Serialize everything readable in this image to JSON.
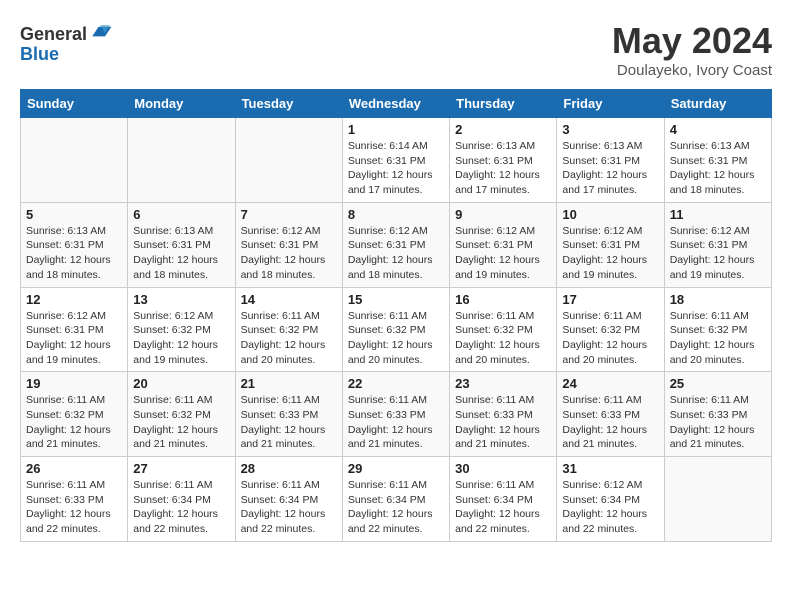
{
  "header": {
    "logo_line1": "General",
    "logo_line2": "Blue",
    "title": "May 2024",
    "location": "Doulayeko, Ivory Coast"
  },
  "days_of_week": [
    "Sunday",
    "Monday",
    "Tuesday",
    "Wednesday",
    "Thursday",
    "Friday",
    "Saturday"
  ],
  "weeks": [
    [
      {
        "num": "",
        "info": ""
      },
      {
        "num": "",
        "info": ""
      },
      {
        "num": "",
        "info": ""
      },
      {
        "num": "1",
        "info": "Sunrise: 6:14 AM\nSunset: 6:31 PM\nDaylight: 12 hours\nand 17 minutes."
      },
      {
        "num": "2",
        "info": "Sunrise: 6:13 AM\nSunset: 6:31 PM\nDaylight: 12 hours\nand 17 minutes."
      },
      {
        "num": "3",
        "info": "Sunrise: 6:13 AM\nSunset: 6:31 PM\nDaylight: 12 hours\nand 17 minutes."
      },
      {
        "num": "4",
        "info": "Sunrise: 6:13 AM\nSunset: 6:31 PM\nDaylight: 12 hours\nand 18 minutes."
      }
    ],
    [
      {
        "num": "5",
        "info": "Sunrise: 6:13 AM\nSunset: 6:31 PM\nDaylight: 12 hours\nand 18 minutes."
      },
      {
        "num": "6",
        "info": "Sunrise: 6:13 AM\nSunset: 6:31 PM\nDaylight: 12 hours\nand 18 minutes."
      },
      {
        "num": "7",
        "info": "Sunrise: 6:12 AM\nSunset: 6:31 PM\nDaylight: 12 hours\nand 18 minutes."
      },
      {
        "num": "8",
        "info": "Sunrise: 6:12 AM\nSunset: 6:31 PM\nDaylight: 12 hours\nand 18 minutes."
      },
      {
        "num": "9",
        "info": "Sunrise: 6:12 AM\nSunset: 6:31 PM\nDaylight: 12 hours\nand 19 minutes."
      },
      {
        "num": "10",
        "info": "Sunrise: 6:12 AM\nSunset: 6:31 PM\nDaylight: 12 hours\nand 19 minutes."
      },
      {
        "num": "11",
        "info": "Sunrise: 6:12 AM\nSunset: 6:31 PM\nDaylight: 12 hours\nand 19 minutes."
      }
    ],
    [
      {
        "num": "12",
        "info": "Sunrise: 6:12 AM\nSunset: 6:31 PM\nDaylight: 12 hours\nand 19 minutes."
      },
      {
        "num": "13",
        "info": "Sunrise: 6:12 AM\nSunset: 6:32 PM\nDaylight: 12 hours\nand 19 minutes."
      },
      {
        "num": "14",
        "info": "Sunrise: 6:11 AM\nSunset: 6:32 PM\nDaylight: 12 hours\nand 20 minutes."
      },
      {
        "num": "15",
        "info": "Sunrise: 6:11 AM\nSunset: 6:32 PM\nDaylight: 12 hours\nand 20 minutes."
      },
      {
        "num": "16",
        "info": "Sunrise: 6:11 AM\nSunset: 6:32 PM\nDaylight: 12 hours\nand 20 minutes."
      },
      {
        "num": "17",
        "info": "Sunrise: 6:11 AM\nSunset: 6:32 PM\nDaylight: 12 hours\nand 20 minutes."
      },
      {
        "num": "18",
        "info": "Sunrise: 6:11 AM\nSunset: 6:32 PM\nDaylight: 12 hours\nand 20 minutes."
      }
    ],
    [
      {
        "num": "19",
        "info": "Sunrise: 6:11 AM\nSunset: 6:32 PM\nDaylight: 12 hours\nand 21 minutes."
      },
      {
        "num": "20",
        "info": "Sunrise: 6:11 AM\nSunset: 6:32 PM\nDaylight: 12 hours\nand 21 minutes."
      },
      {
        "num": "21",
        "info": "Sunrise: 6:11 AM\nSunset: 6:33 PM\nDaylight: 12 hours\nand 21 minutes."
      },
      {
        "num": "22",
        "info": "Sunrise: 6:11 AM\nSunset: 6:33 PM\nDaylight: 12 hours\nand 21 minutes."
      },
      {
        "num": "23",
        "info": "Sunrise: 6:11 AM\nSunset: 6:33 PM\nDaylight: 12 hours\nand 21 minutes."
      },
      {
        "num": "24",
        "info": "Sunrise: 6:11 AM\nSunset: 6:33 PM\nDaylight: 12 hours\nand 21 minutes."
      },
      {
        "num": "25",
        "info": "Sunrise: 6:11 AM\nSunset: 6:33 PM\nDaylight: 12 hours\nand 21 minutes."
      }
    ],
    [
      {
        "num": "26",
        "info": "Sunrise: 6:11 AM\nSunset: 6:33 PM\nDaylight: 12 hours\nand 22 minutes."
      },
      {
        "num": "27",
        "info": "Sunrise: 6:11 AM\nSunset: 6:34 PM\nDaylight: 12 hours\nand 22 minutes."
      },
      {
        "num": "28",
        "info": "Sunrise: 6:11 AM\nSunset: 6:34 PM\nDaylight: 12 hours\nand 22 minutes."
      },
      {
        "num": "29",
        "info": "Sunrise: 6:11 AM\nSunset: 6:34 PM\nDaylight: 12 hours\nand 22 minutes."
      },
      {
        "num": "30",
        "info": "Sunrise: 6:11 AM\nSunset: 6:34 PM\nDaylight: 12 hours\nand 22 minutes."
      },
      {
        "num": "31",
        "info": "Sunrise: 6:12 AM\nSunset: 6:34 PM\nDaylight: 12 hours\nand 22 minutes."
      },
      {
        "num": "",
        "info": ""
      }
    ]
  ]
}
